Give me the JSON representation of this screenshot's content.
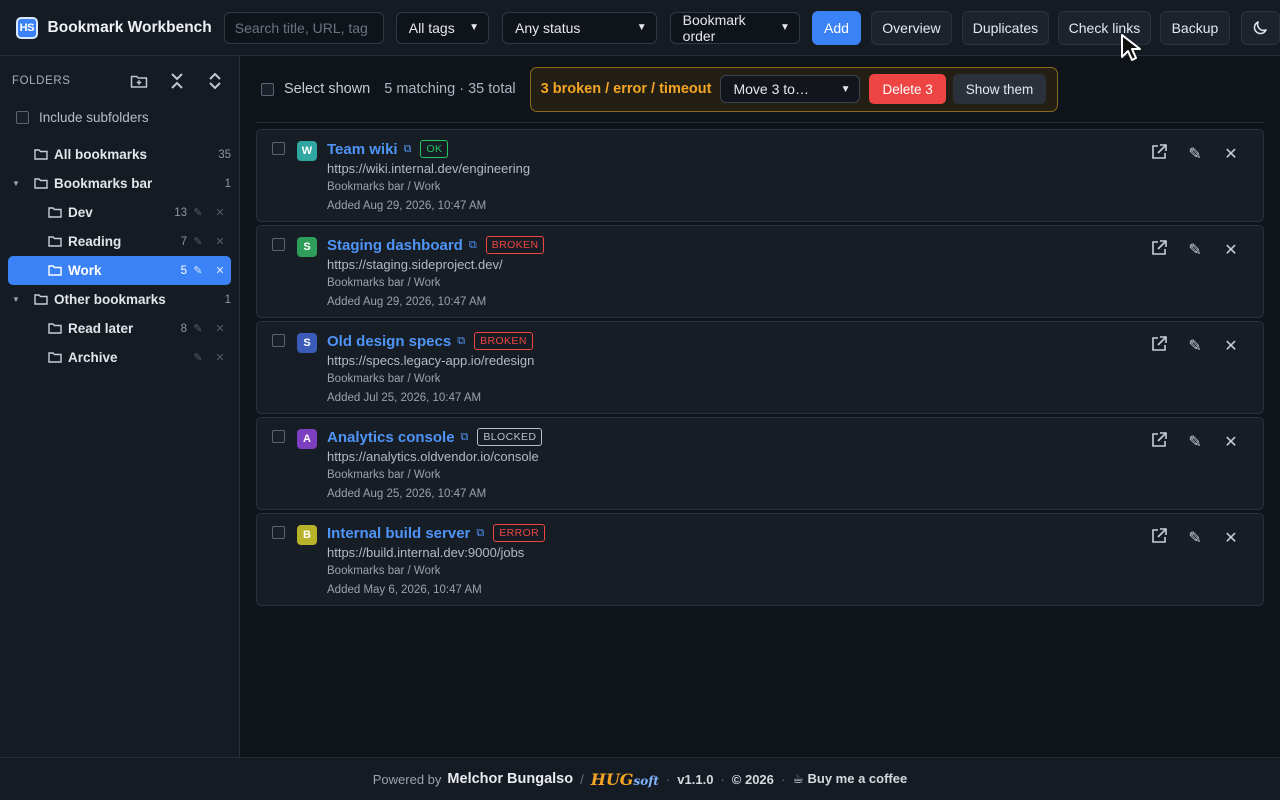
{
  "header": {
    "logo_text": "HS",
    "app_title": "Bookmark Workbench",
    "search_placeholder": "Search title, URL, tag",
    "tag_filter": "All tags",
    "status_filter": "Any status",
    "sort": "Bookmark order",
    "buttons": {
      "add": "Add",
      "overview": "Overview",
      "duplicates": "Duplicates",
      "check_links": "Check links",
      "backup": "Backup"
    }
  },
  "sidebar": {
    "heading": "FOLDERS",
    "include_subfolders": "Include subfolders",
    "tree": [
      {
        "name": "All bookmarks",
        "count": "35"
      },
      {
        "name": "Bookmarks bar",
        "count": "1"
      },
      {
        "name": "Dev",
        "count": "13"
      },
      {
        "name": "Reading",
        "count": "7"
      },
      {
        "name": "Work",
        "count": "5"
      },
      {
        "name": "Other bookmarks",
        "count": "1"
      },
      {
        "name": "Read later",
        "count": "8"
      },
      {
        "name": "Archive",
        "count": ""
      }
    ]
  },
  "toolbar": {
    "select_shown": "Select shown",
    "matching": "5 matching · 35 total",
    "alert_text": "3 broken / error / timeout",
    "move_select": "Move 3 to…",
    "delete_btn": "Delete 3",
    "show_btn": "Show them"
  },
  "bookmarks": [
    {
      "letter": "W",
      "color": "#2fa6a0",
      "title": "Team wiki",
      "status": "OK",
      "status_color": "#22c55e",
      "url": "https://wiki.internal.dev/engineering",
      "path": "Bookmarks bar / Work",
      "added": "Added Aug 29, 2026, 10:47 AM"
    },
    {
      "letter": "S",
      "color": "#2f9e5a",
      "title": "Staging dashboard",
      "status": "BROKEN",
      "status_color": "#ef4444",
      "url": "https://staging.sideproject.dev/",
      "path": "Bookmarks bar / Work",
      "added": "Added Aug 29, 2026, 10:47 AM"
    },
    {
      "letter": "S",
      "color": "#3b5bb8",
      "title": "Old design specs",
      "status": "BROKEN",
      "status_color": "#ef4444",
      "url": "https://specs.legacy-app.io/redesign",
      "path": "Bookmarks bar / Work",
      "added": "Added Jul 25, 2026, 10:47 AM"
    },
    {
      "letter": "A",
      "color": "#7b3fbf",
      "title": "Analytics console",
      "status": "BLOCKED",
      "status_color": "#b8bec7",
      "url": "https://analytics.oldvendor.io/console",
      "path": "Bookmarks bar / Work",
      "added": "Added Aug 25, 2026, 10:47 AM"
    },
    {
      "letter": "B",
      "color": "#b8b22a",
      "title": "Internal build server",
      "status": "ERROR",
      "status_color": "#ef4444",
      "url": "https://build.internal.dev:9000/jobs",
      "path": "Bookmarks bar / Work",
      "added": "Added May 6, 2026, 10:47 AM"
    }
  ],
  "footer": {
    "powered": "Powered by",
    "author": "Melchor Bungalso",
    "brand_main": "HUG",
    "brand_sub": "soft",
    "version": "v1.1.0",
    "year": "© 2026",
    "coffee": "☕ Buy me a coffee"
  }
}
